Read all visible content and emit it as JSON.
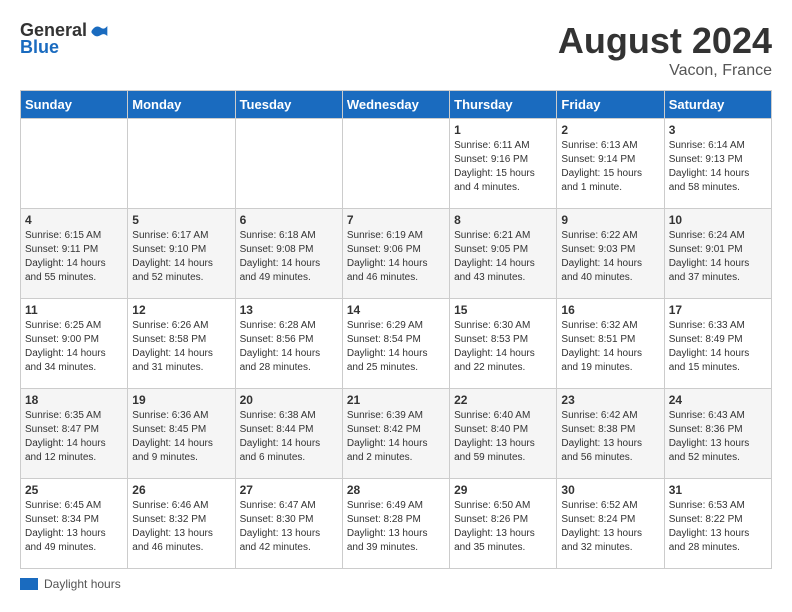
{
  "header": {
    "logo_general": "General",
    "logo_blue": "Blue",
    "month_year": "August 2024",
    "location": "Vacon, France"
  },
  "days_of_week": [
    "Sunday",
    "Monday",
    "Tuesday",
    "Wednesday",
    "Thursday",
    "Friday",
    "Saturday"
  ],
  "legend": {
    "label": "Daylight hours"
  },
  "weeks": [
    [
      {
        "day": "",
        "info": ""
      },
      {
        "day": "",
        "info": ""
      },
      {
        "day": "",
        "info": ""
      },
      {
        "day": "",
        "info": ""
      },
      {
        "day": "1",
        "info": "Sunrise: 6:11 AM\nSunset: 9:16 PM\nDaylight: 15 hours\nand 4 minutes."
      },
      {
        "day": "2",
        "info": "Sunrise: 6:13 AM\nSunset: 9:14 PM\nDaylight: 15 hours\nand 1 minute."
      },
      {
        "day": "3",
        "info": "Sunrise: 6:14 AM\nSunset: 9:13 PM\nDaylight: 14 hours\nand 58 minutes."
      }
    ],
    [
      {
        "day": "4",
        "info": "Sunrise: 6:15 AM\nSunset: 9:11 PM\nDaylight: 14 hours\nand 55 minutes."
      },
      {
        "day": "5",
        "info": "Sunrise: 6:17 AM\nSunset: 9:10 PM\nDaylight: 14 hours\nand 52 minutes."
      },
      {
        "day": "6",
        "info": "Sunrise: 6:18 AM\nSunset: 9:08 PM\nDaylight: 14 hours\nand 49 minutes."
      },
      {
        "day": "7",
        "info": "Sunrise: 6:19 AM\nSunset: 9:06 PM\nDaylight: 14 hours\nand 46 minutes."
      },
      {
        "day": "8",
        "info": "Sunrise: 6:21 AM\nSunset: 9:05 PM\nDaylight: 14 hours\nand 43 minutes."
      },
      {
        "day": "9",
        "info": "Sunrise: 6:22 AM\nSunset: 9:03 PM\nDaylight: 14 hours\nand 40 minutes."
      },
      {
        "day": "10",
        "info": "Sunrise: 6:24 AM\nSunset: 9:01 PM\nDaylight: 14 hours\nand 37 minutes."
      }
    ],
    [
      {
        "day": "11",
        "info": "Sunrise: 6:25 AM\nSunset: 9:00 PM\nDaylight: 14 hours\nand 34 minutes."
      },
      {
        "day": "12",
        "info": "Sunrise: 6:26 AM\nSunset: 8:58 PM\nDaylight: 14 hours\nand 31 minutes."
      },
      {
        "day": "13",
        "info": "Sunrise: 6:28 AM\nSunset: 8:56 PM\nDaylight: 14 hours\nand 28 minutes."
      },
      {
        "day": "14",
        "info": "Sunrise: 6:29 AM\nSunset: 8:54 PM\nDaylight: 14 hours\nand 25 minutes."
      },
      {
        "day": "15",
        "info": "Sunrise: 6:30 AM\nSunset: 8:53 PM\nDaylight: 14 hours\nand 22 minutes."
      },
      {
        "day": "16",
        "info": "Sunrise: 6:32 AM\nSunset: 8:51 PM\nDaylight: 14 hours\nand 19 minutes."
      },
      {
        "day": "17",
        "info": "Sunrise: 6:33 AM\nSunset: 8:49 PM\nDaylight: 14 hours\nand 15 minutes."
      }
    ],
    [
      {
        "day": "18",
        "info": "Sunrise: 6:35 AM\nSunset: 8:47 PM\nDaylight: 14 hours\nand 12 minutes."
      },
      {
        "day": "19",
        "info": "Sunrise: 6:36 AM\nSunset: 8:45 PM\nDaylight: 14 hours\nand 9 minutes."
      },
      {
        "day": "20",
        "info": "Sunrise: 6:38 AM\nSunset: 8:44 PM\nDaylight: 14 hours\nand 6 minutes."
      },
      {
        "day": "21",
        "info": "Sunrise: 6:39 AM\nSunset: 8:42 PM\nDaylight: 14 hours\nand 2 minutes."
      },
      {
        "day": "22",
        "info": "Sunrise: 6:40 AM\nSunset: 8:40 PM\nDaylight: 13 hours\nand 59 minutes."
      },
      {
        "day": "23",
        "info": "Sunrise: 6:42 AM\nSunset: 8:38 PM\nDaylight: 13 hours\nand 56 minutes."
      },
      {
        "day": "24",
        "info": "Sunrise: 6:43 AM\nSunset: 8:36 PM\nDaylight: 13 hours\nand 52 minutes."
      }
    ],
    [
      {
        "day": "25",
        "info": "Sunrise: 6:45 AM\nSunset: 8:34 PM\nDaylight: 13 hours\nand 49 minutes."
      },
      {
        "day": "26",
        "info": "Sunrise: 6:46 AM\nSunset: 8:32 PM\nDaylight: 13 hours\nand 46 minutes."
      },
      {
        "day": "27",
        "info": "Sunrise: 6:47 AM\nSunset: 8:30 PM\nDaylight: 13 hours\nand 42 minutes."
      },
      {
        "day": "28",
        "info": "Sunrise: 6:49 AM\nSunset: 8:28 PM\nDaylight: 13 hours\nand 39 minutes."
      },
      {
        "day": "29",
        "info": "Sunrise: 6:50 AM\nSunset: 8:26 PM\nDaylight: 13 hours\nand 35 minutes."
      },
      {
        "day": "30",
        "info": "Sunrise: 6:52 AM\nSunset: 8:24 PM\nDaylight: 13 hours\nand 32 minutes."
      },
      {
        "day": "31",
        "info": "Sunrise: 6:53 AM\nSunset: 8:22 PM\nDaylight: 13 hours\nand 28 minutes."
      }
    ]
  ]
}
